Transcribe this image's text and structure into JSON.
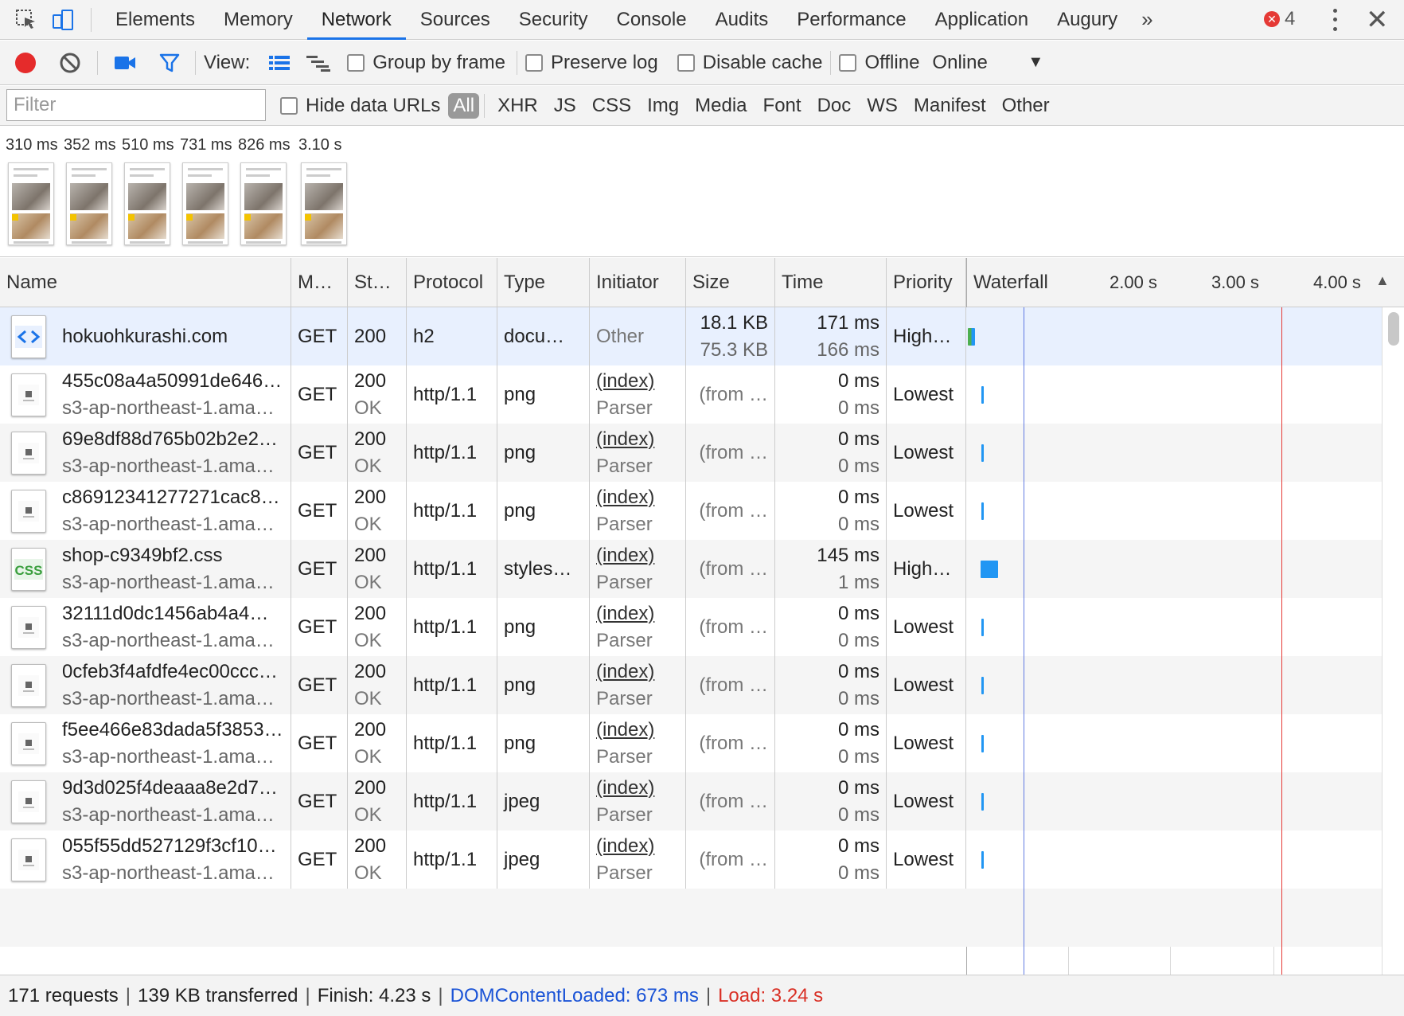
{
  "tabs": [
    "Elements",
    "Memory",
    "Network",
    "Sources",
    "Security",
    "Console",
    "Audits",
    "Performance",
    "Application",
    "Augury"
  ],
  "active_tab": "Network",
  "more_tabs_glyph": "»",
  "error_count": "4",
  "toolbar": {
    "view_label": "View:",
    "group_by_frame": "Group by frame",
    "preserve_log": "Preserve log",
    "disable_cache": "Disable cache",
    "offline": "Offline",
    "throttle": "Online",
    "record_color": "#e52b2b"
  },
  "filter": {
    "placeholder": "Filter",
    "hide_data_urls": "Hide data URLs",
    "types": [
      "All",
      "XHR",
      "JS",
      "CSS",
      "Img",
      "Media",
      "Font",
      "Doc",
      "WS",
      "Manifest",
      "Other"
    ],
    "active_type": "All"
  },
  "filmstrip": [
    "310 ms",
    "352 ms",
    "510 ms",
    "731 ms",
    "826 ms",
    "3.10 s"
  ],
  "columns": [
    "Name",
    "M…",
    "St…",
    "Protocol",
    "Type",
    "Initiator",
    "Size",
    "Time",
    "Priority",
    "Waterfall"
  ],
  "waterfall_ticks": [
    "2.00 s",
    "3.00 s",
    "4.00 s"
  ],
  "rows": [
    {
      "name": "hokuohkurashi.com",
      "domain": "",
      "method": "GET",
      "status": "200",
      "status_text": "",
      "protocol": "h2",
      "type": "docu…",
      "initiator": "Other",
      "initiator_sub": "",
      "size": "18.1 KB",
      "size_sub": "75.3 KB",
      "time": "171 ms",
      "time_sub": "166 ms",
      "priority": "High…",
      "icon": "document-icon"
    },
    {
      "name": "455c08a4a50991de646…",
      "domain": "s3-ap-northeast-1.ama…",
      "method": "GET",
      "status": "200",
      "status_text": "OK",
      "protocol": "http/1.1",
      "type": "png",
      "initiator": "(index)",
      "initiator_sub": "Parser",
      "size": "(from …",
      "size_sub": "",
      "time": "0 ms",
      "time_sub": "0 ms",
      "priority": "Lowest",
      "icon": "image-icon"
    },
    {
      "name": "69e8df88d765b02b2e2…",
      "domain": "s3-ap-northeast-1.ama…",
      "method": "GET",
      "status": "200",
      "status_text": "OK",
      "protocol": "http/1.1",
      "type": "png",
      "initiator": "(index)",
      "initiator_sub": "Parser",
      "size": "(from …",
      "size_sub": "",
      "time": "0 ms",
      "time_sub": "0 ms",
      "priority": "Lowest",
      "icon": "image-icon"
    },
    {
      "name": "c86912341277271cac8…",
      "domain": "s3-ap-northeast-1.ama…",
      "method": "GET",
      "status": "200",
      "status_text": "OK",
      "protocol": "http/1.1",
      "type": "png",
      "initiator": "(index)",
      "initiator_sub": "Parser",
      "size": "(from …",
      "size_sub": "",
      "time": "0 ms",
      "time_sub": "0 ms",
      "priority": "Lowest",
      "icon": "image-icon"
    },
    {
      "name": "shop-c9349bf2.css",
      "domain": "s3-ap-northeast-1.ama…",
      "method": "GET",
      "status": "200",
      "status_text": "OK",
      "protocol": "http/1.1",
      "type": "styles…",
      "initiator": "(index)",
      "initiator_sub": "Parser",
      "size": "(from …",
      "size_sub": "",
      "time": "145 ms",
      "time_sub": "1 ms",
      "priority": "High…",
      "icon": "css-icon"
    },
    {
      "name": "32111d0dc1456ab4a4…",
      "domain": "s3-ap-northeast-1.ama…",
      "method": "GET",
      "status": "200",
      "status_text": "OK",
      "protocol": "http/1.1",
      "type": "png",
      "initiator": "(index)",
      "initiator_sub": "Parser",
      "size": "(from …",
      "size_sub": "",
      "time": "0 ms",
      "time_sub": "0 ms",
      "priority": "Lowest",
      "icon": "image-icon"
    },
    {
      "name": "0cfeb3f4afdfe4ec00ccc…",
      "domain": "s3-ap-northeast-1.ama…",
      "method": "GET",
      "status": "200",
      "status_text": "OK",
      "protocol": "http/1.1",
      "type": "png",
      "initiator": "(index)",
      "initiator_sub": "Parser",
      "size": "(from …",
      "size_sub": "",
      "time": "0 ms",
      "time_sub": "0 ms",
      "priority": "Lowest",
      "icon": "image-icon"
    },
    {
      "name": "f5ee466e83dada5f3853…",
      "domain": "s3-ap-northeast-1.ama…",
      "method": "GET",
      "status": "200",
      "status_text": "OK",
      "protocol": "http/1.1",
      "type": "png",
      "initiator": "(index)",
      "initiator_sub": "Parser",
      "size": "(from …",
      "size_sub": "",
      "time": "0 ms",
      "time_sub": "0 ms",
      "priority": "Lowest",
      "icon": "image-icon"
    },
    {
      "name": "9d3d025f4deaaa8e2d7…",
      "domain": "s3-ap-northeast-1.ama…",
      "method": "GET",
      "status": "200",
      "status_text": "OK",
      "protocol": "http/1.1",
      "type": "jpeg",
      "initiator": "(index)",
      "initiator_sub": "Parser",
      "size": "(from …",
      "size_sub": "",
      "time": "0 ms",
      "time_sub": "0 ms",
      "priority": "Lowest",
      "icon": "image-icon"
    },
    {
      "name": "055f55dd527129f3cf10…",
      "domain": "s3-ap-northeast-1.ama…",
      "method": "GET",
      "status": "200",
      "status_text": "OK",
      "protocol": "http/1.1",
      "type": "jpeg",
      "initiator": "(index)",
      "initiator_sub": "Parser",
      "size": "(from …",
      "size_sub": "",
      "time": "0 ms",
      "time_sub": "0 ms",
      "priority": "Lowest",
      "icon": "image-icon"
    }
  ],
  "status": {
    "requests": "171 requests",
    "transferred": "139 KB transferred",
    "finish": "Finish: 4.23 s",
    "dom_content_loaded": "DOMContentLoaded: 673 ms",
    "load": "Load: 3.24 s",
    "dcl_color": "#1a53d6",
    "load_color": "#d93025"
  }
}
